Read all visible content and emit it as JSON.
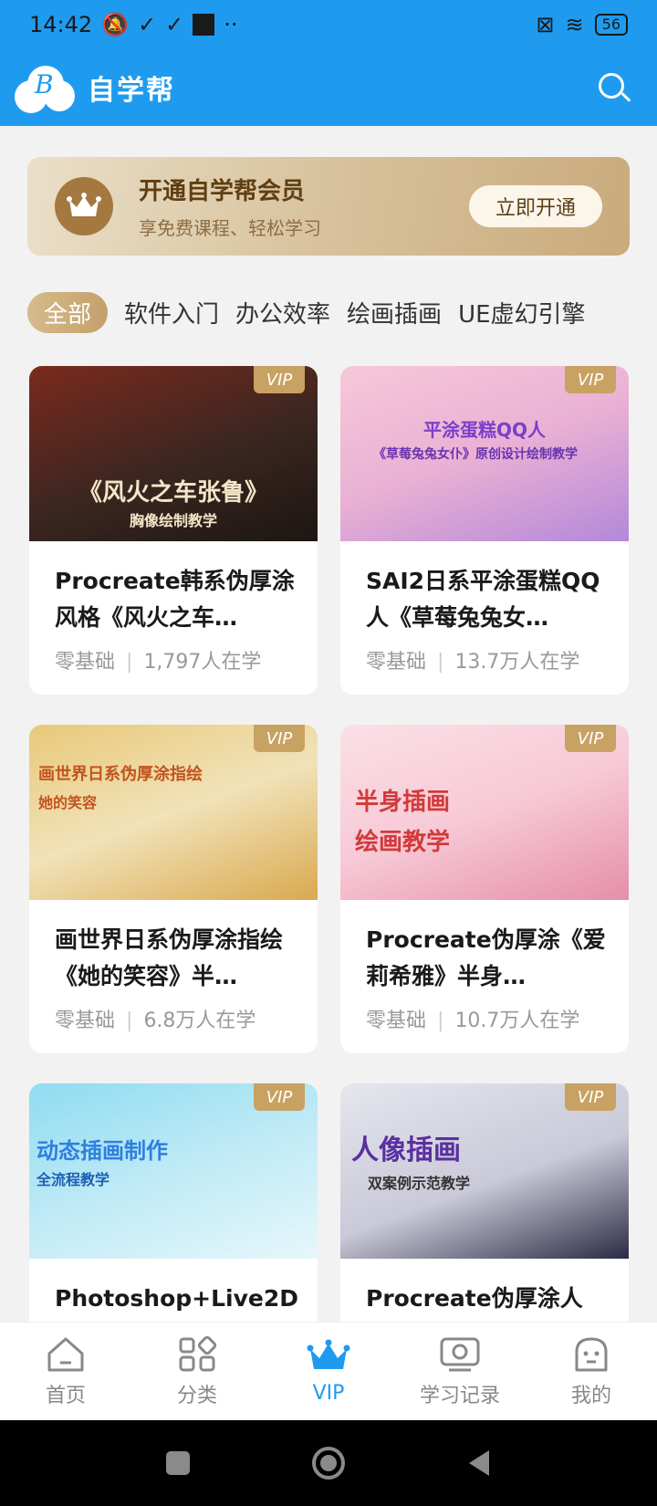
{
  "status_bar": {
    "time": "14:42",
    "dots": "··",
    "battery": "56"
  },
  "app_bar": {
    "logo_letter": "B",
    "title": "自学帮"
  },
  "vip_banner": {
    "title": "开通自学帮会员",
    "subtitle": "享免费课程、轻松学习",
    "button_label": "立即开通"
  },
  "tabs": [
    "全部",
    "软件入门",
    "办公效率",
    "绘画插画",
    "UE虚幻引擎"
  ],
  "courses": [
    {
      "title": "Procreate韩系伪厚涂风格《风火之车…",
      "level": "零基础",
      "learners": "1,797人在学",
      "badge": "VIP",
      "thumb_caption": "《风火之车张鲁》",
      "thumb_sub": "胸像绘制教学"
    },
    {
      "title": "SAI2日系平涂蛋糕QQ人《草莓兔兔女…",
      "level": "零基础",
      "learners": "13.7万人在学",
      "badge": "VIP",
      "thumb_caption": "平涂蛋糕QQ人",
      "thumb_sub": "《草莓兔兔女仆》原创设计绘制教学"
    },
    {
      "title": "画世界日系伪厚涂指绘《她的笑容》半…",
      "level": "零基础",
      "learners": "6.8万人在学",
      "badge": "VIP",
      "thumb_caption": "画世界日系伪厚涂指绘",
      "thumb_sub": "她的笑容"
    },
    {
      "title": "Procreate伪厚涂《爱莉希雅》半身…",
      "level": "零基础",
      "learners": "10.7万人在学",
      "badge": "VIP",
      "thumb_caption": "半身插画",
      "thumb_sub": "绘画教学"
    },
    {
      "title": "Photoshop+Live2D",
      "level": "",
      "learners": "",
      "badge": "VIP",
      "thumb_caption": "动态插画制作",
      "thumb_sub": "全流程教学"
    },
    {
      "title": "Procreate伪厚涂人",
      "level": "",
      "learners": "",
      "badge": "VIP",
      "thumb_caption": "人像插画",
      "thumb_sub": "双案例示范教学"
    }
  ],
  "bottom_nav": [
    "首页",
    "分类",
    "VIP",
    "学习记录",
    "我的"
  ],
  "colors": {
    "primary": "#1e9bef",
    "gold": "#c8a262",
    "bg": "#f2f2f2"
  }
}
